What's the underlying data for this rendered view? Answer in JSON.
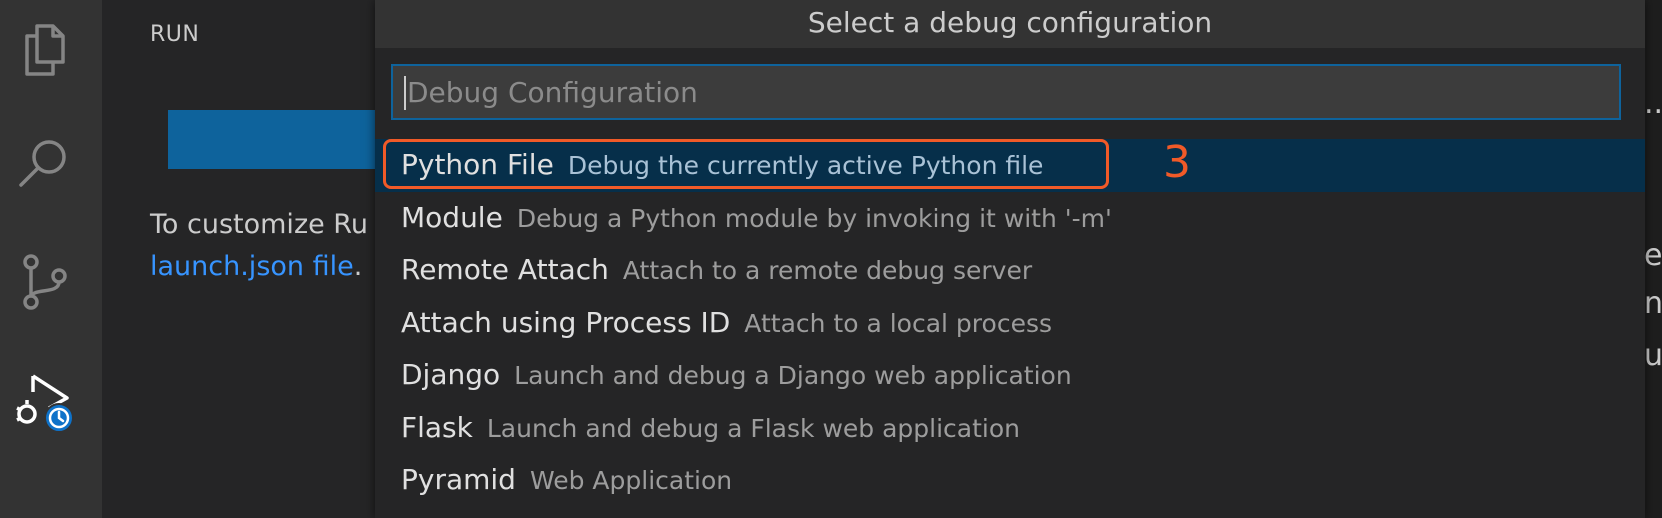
{
  "sidebar": {
    "title": "RUN",
    "customize_text": "To customize Ru",
    "link_text": "launch.json file",
    "link_suffix": "."
  },
  "editor_fragments": [
    "..",
    "e_",
    "n",
    "ur"
  ],
  "quick_pick": {
    "title": "Select a debug configuration",
    "input": {
      "value": "",
      "placeholder": "Debug Configuration"
    },
    "items": [
      {
        "label": "Python File",
        "description": "Debug the currently active Python file"
      },
      {
        "label": "Module",
        "description": "Debug a Python module by invoking it with '-m'"
      },
      {
        "label": "Remote Attach",
        "description": "Attach to a remote debug server"
      },
      {
        "label": "Attach using Process ID",
        "description": "Attach to a local process"
      },
      {
        "label": "Django",
        "description": "Launch and debug a Django web application"
      },
      {
        "label": "Flask",
        "description": "Launch and debug a Flask web application"
      },
      {
        "label": "Pyramid",
        "description": "Web Application"
      }
    ]
  },
  "annotation": {
    "number": "3",
    "color": "#f05a28"
  },
  "icons": [
    "files-icon",
    "search-icon",
    "source-control-icon",
    "run-debug-icon"
  ],
  "colors": {
    "accent": "#0e639c",
    "selection": "#062f4a",
    "link": "#3794ff"
  }
}
